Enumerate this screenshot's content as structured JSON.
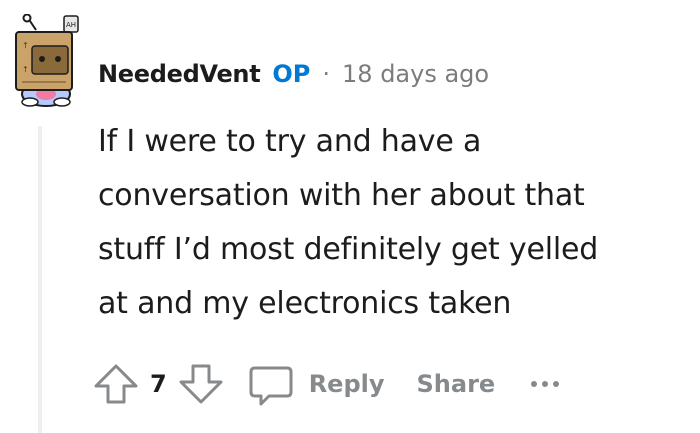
{
  "comment": {
    "author": "NeededVent",
    "op_badge": "OP",
    "separator": "·",
    "timestamp": "18 days ago",
    "body_lines": [
      "If I were to try and have a",
      "conversation with her about that",
      "stuff I’d most definitely get yelled",
      "at and my electronics taken"
    ]
  },
  "actions": {
    "vote_count": "7",
    "reply_label": "Reply",
    "share_label": "Share",
    "upvote_icon": "arrow-up-outline-icon",
    "downvote_icon": "arrow-down-outline-icon",
    "reply_icon": "speech-bubble-icon",
    "more_icon": "horizontal-ellipsis-icon"
  },
  "colors": {
    "op_accent": "#0079d3",
    "muted_text": "#878a8c",
    "body_text": "#1c1c1c",
    "thread_line": "#edeff1"
  }
}
